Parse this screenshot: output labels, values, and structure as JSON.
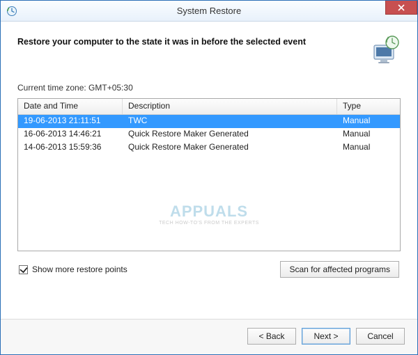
{
  "window": {
    "title": "System Restore",
    "close_tooltip": "Close"
  },
  "heading": "Restore your computer to the state it was in before the selected event",
  "timezone_label": "Current time zone: GMT+05:30",
  "table": {
    "columns": {
      "date": "Date and Time",
      "description": "Description",
      "type": "Type"
    },
    "rows": [
      {
        "date": "19-06-2013 21:11:51",
        "description": "TWC",
        "type": "Manual",
        "selected": true
      },
      {
        "date": "16-06-2013 14:46:21",
        "description": "Quick Restore Maker Generated",
        "type": "Manual",
        "selected": false
      },
      {
        "date": "14-06-2013 15:59:36",
        "description": "Quick Restore Maker Generated",
        "type": "Manual",
        "selected": false
      }
    ]
  },
  "show_more": {
    "label": "Show more restore points",
    "checked": true
  },
  "scan_button": "Scan for affected programs",
  "footer": {
    "back": "< Back",
    "next": "Next >",
    "cancel": "Cancel"
  },
  "watermark": {
    "brand": "APPUALS",
    "tagline": "TECH HOW-TO'S FROM THE EXPERTS"
  }
}
